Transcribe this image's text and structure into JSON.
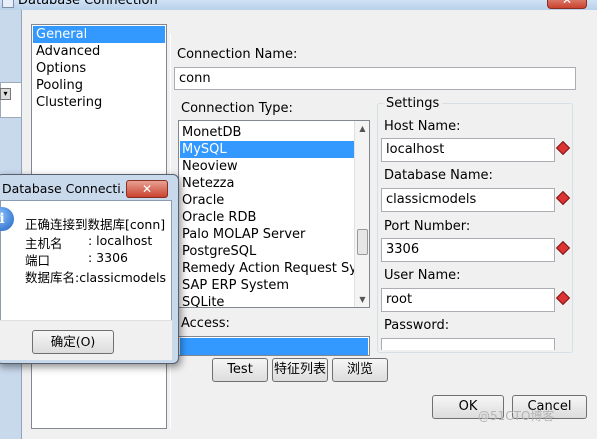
{
  "window": {
    "title": "Database Connection",
    "close_glyph": "✕"
  },
  "nav": {
    "items": [
      "General",
      "Advanced",
      "Options",
      "Pooling",
      "Clustering"
    ],
    "selected": "General"
  },
  "connection_name": {
    "label": "Connection Name:",
    "value": "conn"
  },
  "connection_type": {
    "label": "Connection Type:",
    "items": [
      "MonetDB",
      "MySQL",
      "Neoview",
      "Netezza",
      "Oracle",
      "Oracle RDB",
      "Palo MOLAP Server",
      "PostgreSQL",
      "Remedy Action Request Syste",
      "SAP ERP System",
      "SQLite"
    ],
    "selected": "MySQL"
  },
  "access": {
    "label": "Access:"
  },
  "settings": {
    "legend": "Settings",
    "host": {
      "label": "Host Name:",
      "value": "localhost"
    },
    "database": {
      "label": "Database Name:",
      "value": "classicmodels"
    },
    "port": {
      "label": "Port Number:",
      "value": "3306"
    },
    "user": {
      "label": "User Name:",
      "value": "root"
    },
    "password": {
      "label": "Password:"
    }
  },
  "buttons": {
    "test": "Test",
    "feature_list": "特征列表",
    "browse": "浏览",
    "ok": "OK",
    "cancel": "Cancel"
  },
  "message_box": {
    "title": "Database Connecti...",
    "close_glyph": "✕",
    "icon_glyph": "i",
    "line1": "正确连接到数据库[conn]",
    "host_label": "主机名",
    "host_value": ": localhost",
    "port_label": "端口",
    "port_value": ": 3306",
    "db_line": "数据库名:classicmodels",
    "ok_button": "确定(O)"
  },
  "watermark": "@51CTO博客",
  "colors": {
    "selection": "#3399ff",
    "required": "#dd3333",
    "title_bar": "#b9d1ea"
  }
}
